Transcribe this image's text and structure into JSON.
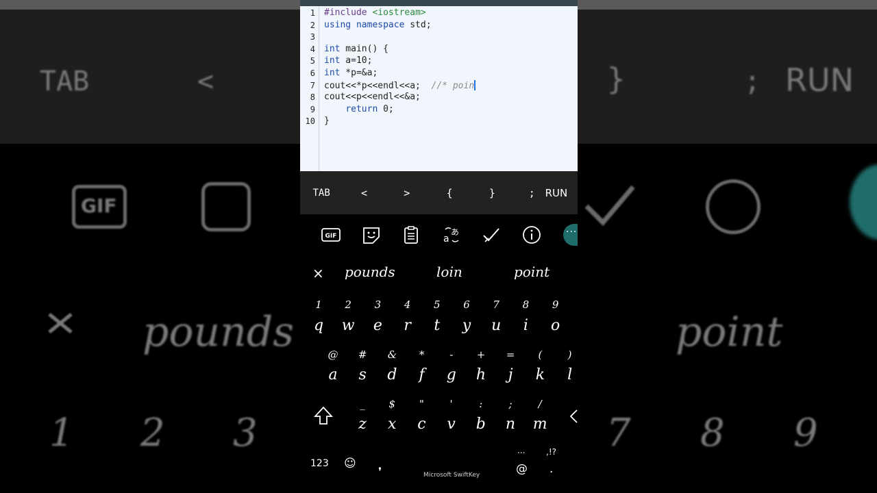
{
  "editor": {
    "lines": [
      {
        "n": "1",
        "segments": [
          [
            "kw-inc",
            "#include "
          ],
          [
            "str",
            "<iostream>"
          ]
        ]
      },
      {
        "n": "2",
        "segments": [
          [
            "kw",
            "using namespace"
          ],
          [
            "plain",
            " std;"
          ]
        ]
      },
      {
        "n": "3",
        "segments": []
      },
      {
        "n": "4",
        "segments": [
          [
            "kw",
            "int"
          ],
          [
            "plain",
            " main() {"
          ]
        ]
      },
      {
        "n": "5",
        "segments": [
          [
            "kw",
            "int"
          ],
          [
            "plain",
            " a=10;"
          ]
        ]
      },
      {
        "n": "6",
        "segments": [
          [
            "kw",
            "int"
          ],
          [
            "plain",
            " *p=&a;"
          ]
        ]
      },
      {
        "n": "7",
        "segments": [
          [
            "plain",
            "cout<<*p<<endl<<a;  "
          ],
          [
            "cmt",
            "//* poin"
          ]
        ]
      },
      {
        "n": "8",
        "segments": [
          [
            "plain",
            "cout<<p<<endl<<&a;"
          ]
        ]
      },
      {
        "n": "9",
        "segments": [
          [
            "plain",
            "    "
          ],
          [
            "kw",
            "return"
          ],
          [
            "plain",
            " 0;"
          ]
        ]
      },
      {
        "n": "10",
        "segments": [
          [
            "plain",
            "}"
          ]
        ]
      }
    ]
  },
  "toolbar": {
    "tab": "TAB",
    "lt": "<",
    "gt": ">",
    "lbrace": "{",
    "rbrace": "}",
    "semi": ";",
    "run": "RUN"
  },
  "keyboard": {
    "tools": [
      "gif-icon",
      "sticker-icon",
      "clipboard-icon",
      "translate-icon",
      "check-icon",
      "info-icon",
      "more-icon"
    ],
    "suggestions": {
      "close": "×",
      "left": "pounds",
      "center": "loin",
      "right": "point"
    },
    "row1": {
      "main": [
        "q",
        "w",
        "e",
        "r",
        "t",
        "y",
        "u",
        "i",
        "o"
      ],
      "alt": [
        "1",
        "2",
        "3",
        "4",
        "5",
        "6",
        "7",
        "8",
        "9"
      ]
    },
    "row2": {
      "main": [
        "a",
        "s",
        "d",
        "f",
        "g",
        "h",
        "j",
        "k",
        "l"
      ],
      "alt": [
        "@",
        "#",
        "&",
        "*",
        "-",
        "+",
        "=",
        "(",
        ")"
      ]
    },
    "row3": {
      "main": [
        "z",
        "x",
        "c",
        "v",
        "b",
        "n",
        "m"
      ],
      "alt": [
        "_",
        "$",
        "\"",
        "'",
        ":",
        ";",
        "/"
      ]
    },
    "bottom": {
      "numbers": "123",
      "emoji": "☺",
      "brand": "Microsoft SwiftKey",
      "ellipsis": "...",
      "punct": ",!?",
      "at": "@",
      "period": "."
    }
  },
  "background": {
    "tab": "TAB",
    "lt": "<",
    "rbrace": "}",
    "semi": ";",
    "run": "RUN",
    "gif": "GIF",
    "pounds": "pounds",
    "point": "point",
    "n1": "1",
    "n2": "2",
    "n3": "3",
    "n7": "7",
    "n8": "8",
    "n9": "9"
  }
}
